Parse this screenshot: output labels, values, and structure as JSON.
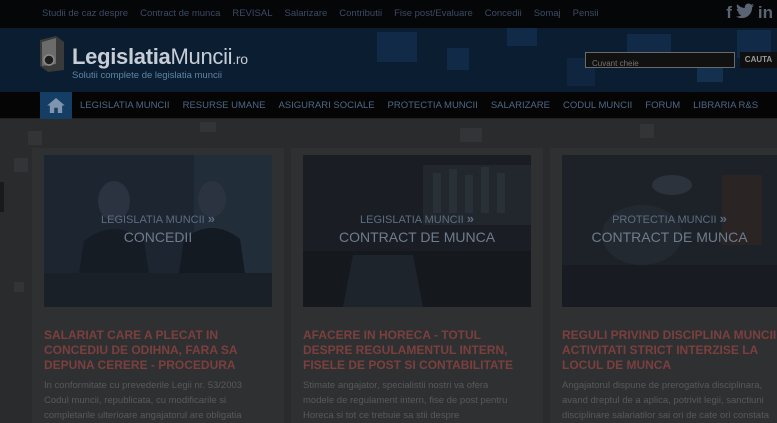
{
  "topbar": {
    "links": [
      "Studii de caz despre",
      "Contract de munca",
      "REVISAL",
      "Salarizare",
      "Contributii",
      "Fise post/Evaluare",
      "Concedii",
      "Somaj",
      "Pensii"
    ],
    "social": {
      "facebook": "f",
      "twitter": "t",
      "linkedin": "in"
    }
  },
  "header": {
    "logo_bold": "Legislatia",
    "logo_regular": "Muncii",
    "logo_suffix": ".ro",
    "tagline": "Solutii complete de legislatia muncii",
    "search_placeholder": "Cuvant cheie",
    "search_button": "CAUTA"
  },
  "nav": {
    "home_icon": "home-icon",
    "items": [
      "LEGISLATIA MUNCII",
      "RESURSE UMANE",
      "ASIGURARI SOCIALE",
      "PROTECTIA MUNCII",
      "SALARIZARE",
      "CODUL MUNCII",
      "FORUM",
      "LIBRARIA R&S"
    ]
  },
  "cards": [
    {
      "category": "LEGISLATIA MUNCII",
      "subcategory": "CONCEDII",
      "title_lines": [
        "SALARIAT CARE A PLECAT IN",
        "CONCEDIU DE ODIHNA, FARA SA",
        "DEPUNA CERERE - PROCEDURA"
      ],
      "text_lines": [
        "In conformitate cu prevederile Legii nr. 53/2003",
        "Codul muncii, republicata, cu modificarile si",
        "completarile ulterioare angajatorul are obligatia"
      ]
    },
    {
      "category": "LEGISLATIA MUNCII",
      "subcategory": "CONTRACT DE MUNCA",
      "title_lines": [
        "AFACERE IN HORECA - TOTUL",
        "DESPRE REGULAMENTUL INTERN,",
        "FISELE DE POST SI CONTABILITATE"
      ],
      "text_lines": [
        "Stimate angajator, specialistii nostri va ofera",
        "modele de regulament intern, fise de post pentru",
        "Horeca si tot ce trebuie sa stii despre"
      ]
    },
    {
      "category": "PROTECTIA MUNCII",
      "subcategory": "CONTRACT DE MUNCA",
      "title_lines": [
        "REGULI PRIVIND DISCIPLINA MUNCII",
        "ACTIVITATI STRICT INTERZISE LA",
        "LOCUL DE MUNCA"
      ],
      "text_lines": [
        "Angajatorul dispune de prerogativa disciplinara,",
        "avand dreptul de a aplica, potrivit legii, sanctiuni",
        "disciplinare salariatilor sai ori de cate ori constata"
      ]
    }
  ]
}
